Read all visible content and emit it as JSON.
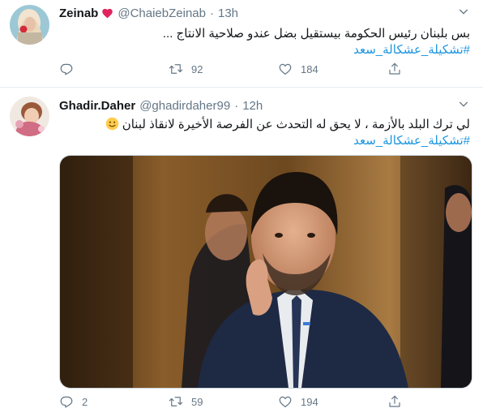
{
  "tweets": [
    {
      "name": "Zeinab",
      "handle": "@ChaiebZeinab",
      "separator": "·",
      "time": "13h",
      "body_line1": "بس بلبنان رئيس الحكومة بيستقيل بضل عندو صلاحية الانتاج ...",
      "hashtag": "#تشكيلة_عشكالة_سعد",
      "replies": "",
      "retweets": "92",
      "likes": "184"
    },
    {
      "name": "Ghadir.Daher",
      "handle": "@ghadirdaher99",
      "separator": "·",
      "time": "12h",
      "body_line1": "لي ترك البلد بالأزمة ، لا يحق له التحدث عن الفرصة الأخيرة لانقاذ لبنان",
      "hashtag": "#تشكيلة_عشكالة_سعد",
      "replies": "2",
      "retweets": "59",
      "likes": "194"
    }
  ],
  "colors": {
    "link": "#1b95e0",
    "muted": "#657786",
    "heart": "#e0245e",
    "divider": "#e6ecf0"
  },
  "icons": [
    "chevron-down-icon",
    "reply-icon",
    "retweet-icon",
    "like-icon",
    "share-icon",
    "red-heart-icon",
    "slightly-smiling-face-icon"
  ]
}
